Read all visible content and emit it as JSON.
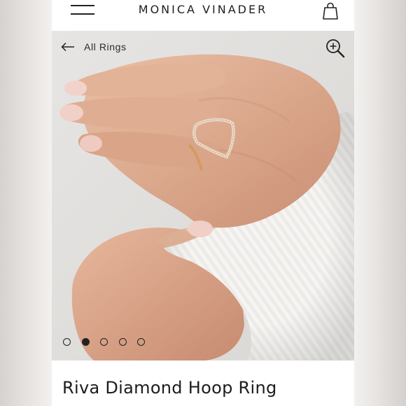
{
  "header": {
    "brand": "MONICA VINADER",
    "menu_icon": "hamburger-menu-icon",
    "bag_icon": "shopping-bag-icon"
  },
  "gallery": {
    "back_label": "All Rings",
    "back_icon": "arrow-left-icon",
    "zoom_icon": "zoom-in-icon",
    "image_count": 5,
    "active_index": 2
  },
  "product": {
    "title": "Riva Diamond Hoop Ring"
  },
  "colors": {
    "text": "#1e1e1e",
    "background": "#ffffff",
    "ring_gold": "#d8a266"
  }
}
